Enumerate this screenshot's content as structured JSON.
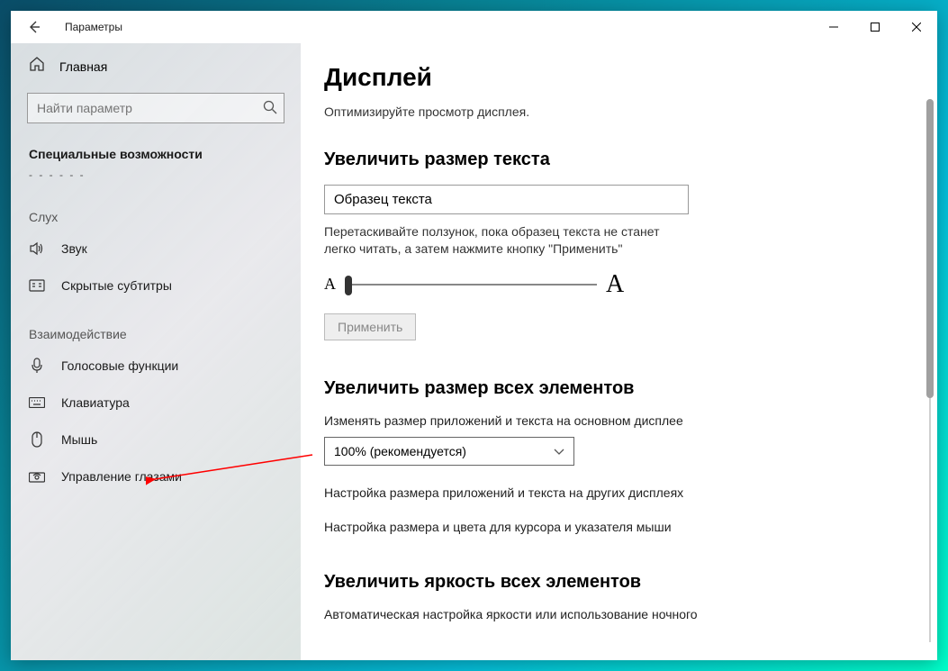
{
  "window": {
    "title": "Параметры"
  },
  "sidebar": {
    "home": "Главная",
    "search_placeholder": "Найти параметр",
    "category": "Специальные возможности",
    "group_hearing": "Слух",
    "group_interaction": "Взаимодействие",
    "items_hearing": [
      {
        "label": "Звук"
      },
      {
        "label": "Скрытые субтитры"
      }
    ],
    "items_interaction": [
      {
        "label": "Голосовые функции"
      },
      {
        "label": "Клавиатура"
      },
      {
        "label": "Мышь"
      },
      {
        "label": "Управление глазами"
      }
    ]
  },
  "main": {
    "heading": "Дисплей",
    "optimize_desc": "Оптимизируйте просмотр дисплея.",
    "text_size_heading": "Увеличить размер текста",
    "sample_text": "Образец текста",
    "slider_help": "Перетаскивайте ползунок, пока образец текста не станет легко читать, а затем нажмите кнопку \"Применить\"",
    "apply_label": "Применить",
    "scale_heading": "Увеличить размер всех элементов",
    "scale_sublabel": "Изменять размер приложений и текста на основном дисплее",
    "scale_value": "100% (рекомендуется)",
    "other_displays_link": "Настройка размера приложений и текста на других дисплеях",
    "cursor_link": "Настройка размера и цвета для курсора и указателя мыши",
    "brightness_heading": "Увеличить яркость всех элементов",
    "brightness_desc": "Автоматическая настройка яркости или использование ночного"
  }
}
